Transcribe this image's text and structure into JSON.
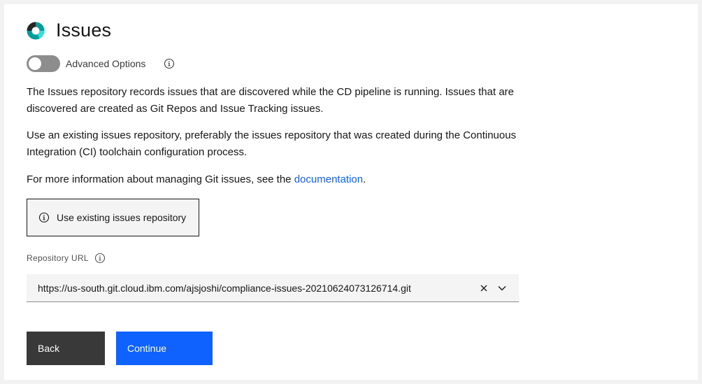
{
  "header": {
    "title": "Issues",
    "logo_icon": "ibm-toolchain-ring-icon"
  },
  "advanced": {
    "label": "Advanced Options",
    "toggle_on": false
  },
  "description": {
    "p1": "The Issues repository records issues that are discovered while the CD pipeline is running. Issues that are discovered are created as Git Repos and Issue Tracking issues.",
    "p2": "Use an existing issues repository, preferably the issues repository that was created during the Continuous Integration (CI) toolchain configuration process.",
    "p3_prefix": "For more information about managing Git issues, see the ",
    "p3_link": "documentation",
    "p3_suffix": "."
  },
  "notice": {
    "label": "Use existing issues repository"
  },
  "repository": {
    "label": "Repository URL",
    "value": "https://us-south.git.cloud.ibm.com/ajsjoshi/compliance-issues-20210624073126714.git"
  },
  "actions": {
    "back_label": "Back",
    "continue_label": "Continue"
  },
  "colors": {
    "primary": "#0f62fe",
    "secondary": "#393939",
    "logo_teal": "#1192e8",
    "logo_dark": "#262626"
  }
}
